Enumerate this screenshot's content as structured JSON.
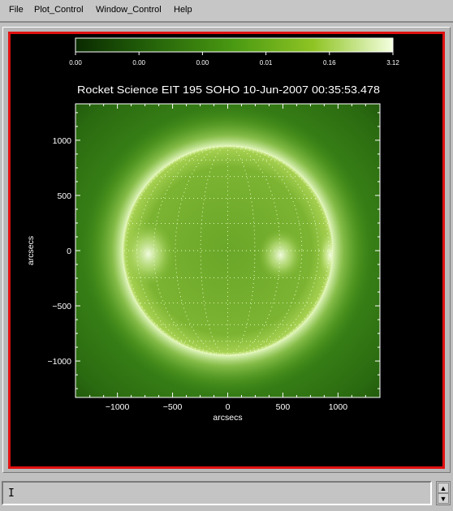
{
  "menu": {
    "items": [
      {
        "label": "File"
      },
      {
        "label": "Plot_Control"
      },
      {
        "label": "Window_Control"
      },
      {
        "label": "Help"
      }
    ]
  },
  "colorbar": {
    "ticks": [
      "0.00",
      "0.00",
      "0.00",
      "0.01",
      "0.16",
      "3.12"
    ]
  },
  "plot": {
    "title": "Rocket Science EIT 195 SOHO 10-Jun-2007 00:35:53.478"
  },
  "chart_data": {
    "type": "heatmap",
    "title": "Rocket Science EIT 195 SOHO 10-Jun-2007 00:35:53.478",
    "xlabel": "arcsecs",
    "ylabel": "arcsecs",
    "xlim": [
      -1380,
      1380
    ],
    "ylim": [
      -1330,
      1330
    ],
    "x_ticks": [
      -1000,
      -500,
      0,
      500,
      1000
    ],
    "y_ticks": [
      -1000,
      -500,
      0,
      500,
      1000
    ],
    "x_tick_labels": [
      "−1000",
      "−500",
      "0",
      "500",
      "1000"
    ],
    "y_tick_labels": [
      "−1000",
      "−500",
      "0",
      "500",
      "1000"
    ],
    "colormap": "green",
    "colorbar_ticks": [
      "0.00",
      "0.00",
      "0.00",
      "0.01",
      "0.16",
      "3.12"
    ]
  },
  "status": {
    "text": "I"
  },
  "colors": {
    "frame": "#e01010",
    "background": "#000000",
    "disk_bright": "#d8f0a8",
    "disk_dark": "#2a6b10"
  }
}
